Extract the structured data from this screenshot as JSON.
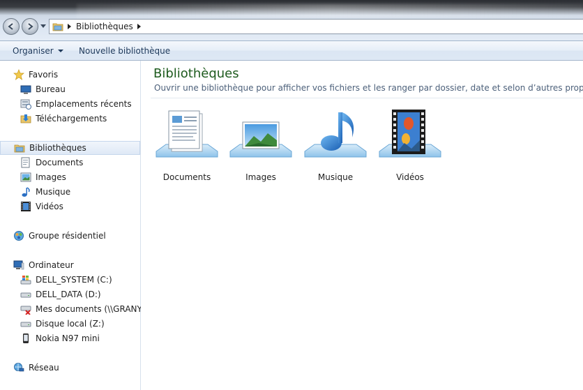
{
  "addressbar": {
    "crumbs": [
      "Bibliothèques"
    ]
  },
  "toolbar": {
    "organize_label": "Organiser",
    "new_library_label": "Nouvelle bibliothèque"
  },
  "navpane": {
    "favorites": {
      "label": "Favoris",
      "items": [
        {
          "label": "Bureau",
          "icon": "desktop-icon"
        },
        {
          "label": "Emplacements récents",
          "icon": "recent-places-icon"
        },
        {
          "label": "Téléchargements",
          "icon": "downloads-folder-icon"
        }
      ]
    },
    "libraries": {
      "label": "Bibliothèques",
      "items": [
        {
          "label": "Documents",
          "icon": "documents-icon"
        },
        {
          "label": "Images",
          "icon": "pictures-icon"
        },
        {
          "label": "Musique",
          "icon": "music-icon"
        },
        {
          "label": "Vidéos",
          "icon": "videos-icon"
        }
      ]
    },
    "homegroup": {
      "label": "Groupe résidentiel"
    },
    "computer": {
      "label": "Ordinateur",
      "items": [
        {
          "label": "DELL_SYSTEM (C:)",
          "icon": "system-drive-icon"
        },
        {
          "label": "DELL_DATA (D:)",
          "icon": "hard-drive-icon"
        },
        {
          "label": "Mes documents (\\\\GRANY-E",
          "icon": "network-drive-disconnected-icon"
        },
        {
          "label": "Disque local (Z:)",
          "icon": "hard-drive-icon"
        },
        {
          "label": "Nokia N97 mini",
          "icon": "phone-icon"
        }
      ]
    },
    "network": {
      "label": "Réseau"
    }
  },
  "content": {
    "title": "Bibliothèques",
    "subtitle": "Ouvrir une bibliothèque pour afficher vos fichiers et les ranger par dossier, date et selon d’autres propriétés",
    "libraries": [
      {
        "label": "Documents",
        "icon": "documents-library-icon"
      },
      {
        "label": "Images",
        "icon": "pictures-library-icon"
      },
      {
        "label": "Musique",
        "icon": "music-library-icon"
      },
      {
        "label": "Vidéos",
        "icon": "videos-library-icon"
      }
    ]
  },
  "colors": {
    "title_green": "#1e5b1e",
    "subtitle_blue": "#4c607a",
    "toolbar_text": "#1e395b",
    "selection_border": "#c5d6ec"
  }
}
